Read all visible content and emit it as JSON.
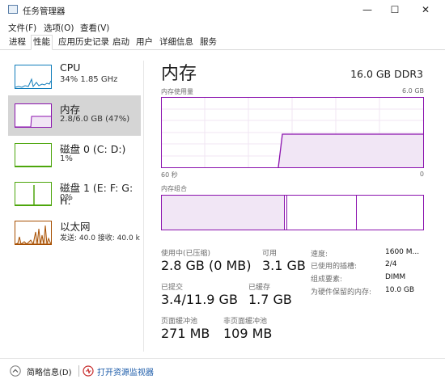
{
  "window": {
    "title": "任务管理器",
    "min_glyph": "—",
    "max_glyph": "☐",
    "close_glyph": "✕"
  },
  "menu": [
    "文件(F)",
    "选项(O)",
    "查看(V)"
  ],
  "tabs": [
    "进程",
    "性能",
    "应用历史记录",
    "启动",
    "用户",
    "详细信息",
    "服务"
  ],
  "sidebar": [
    {
      "title": "CPU",
      "sub": "34% 1.85 GHz",
      "color": "#117dbb"
    },
    {
      "title": "内存",
      "sub": "2.8/6.0 GB (47%)",
      "color": "#8b12ae"
    },
    {
      "title": "磁盘 0 (C: D:)",
      "sub": "1%",
      "color": "#4da60c"
    },
    {
      "title": "磁盘 1 (E: F: G: H:",
      "sub": "0%",
      "color": "#4da60c"
    },
    {
      "title": "以太网",
      "sub": "发送: 40.0 接收: 40.0 k",
      "color": "#a74f01"
    }
  ],
  "main": {
    "title": "内存",
    "spec": "16.0 GB DDR3",
    "usage_label": "内存使用量",
    "usage_max": "6.0 GB",
    "time_left": "60 秒",
    "time_right": "0",
    "composition_label": "内存组合",
    "usage_level": 0.47
  },
  "stats": {
    "in_use_label": "使用中(已压缩)",
    "in_use_value": "2.8 GB (0 MB)",
    "available_label": "可用",
    "available_value": "3.1 GB",
    "committed_label": "已提交",
    "committed_value": "3.4/11.9 GB",
    "cached_label": "已缓存",
    "cached_value": "1.7 GB",
    "paged_label": "页面缓冲池",
    "paged_value": "271 MB",
    "nonpaged_label": "非页面缓冲池",
    "nonpaged_value": "109 MB"
  },
  "props": [
    {
      "label": "速度:",
      "value": "1600 M..."
    },
    {
      "label": "已使用的插槽:",
      "value": "2/4"
    },
    {
      "label": "组成要素:",
      "value": "DIMM"
    },
    {
      "label": "为硬件保留的内存:",
      "value": "10.0 GB"
    }
  ],
  "footer": {
    "summary_label": "简略信息(D)",
    "monitor_label": "打开资源监视器"
  },
  "accent": "#8b12ae"
}
